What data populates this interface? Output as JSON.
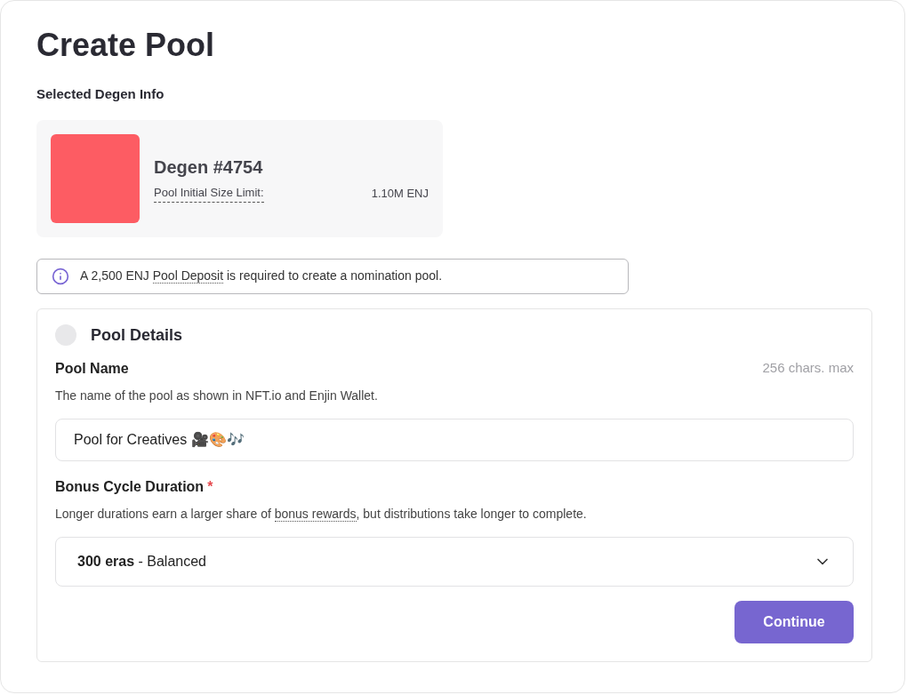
{
  "title": "Create Pool",
  "selected_section": {
    "heading": "Selected Degen Info",
    "name": "Degen #4754",
    "limit_label": "Pool Initial Size Limit:",
    "limit_value": "1.10M ENJ"
  },
  "notice": {
    "before": "A 2,500 ENJ ",
    "term": "Pool Deposit",
    "after": " is required to create a nomination pool."
  },
  "details": {
    "title": "Pool Details",
    "step_done": false,
    "pool_name": {
      "label": "Pool Name",
      "hint": "256 chars. max",
      "description": "The name of the pool as shown in NFT.io and Enjin Wallet.",
      "value": "Pool for Creatives 🎥🎨🎶"
    },
    "bonus": {
      "label": "Bonus Cycle Duration",
      "required_mark": "*",
      "description_before": "Longer durations earn a larger share of ",
      "description_term": "bonus rewards",
      "description_after": ", but distributions take longer to complete.",
      "value_bold": "300 eras",
      "value_rest": " - Balanced"
    },
    "button": "Continue"
  }
}
